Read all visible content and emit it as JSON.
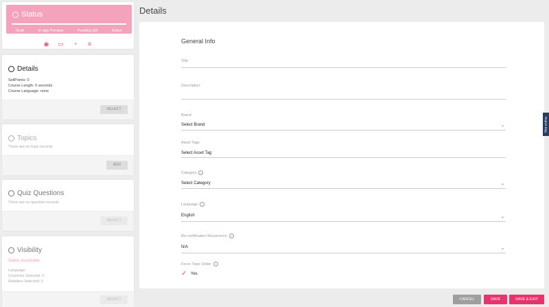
{
  "sidebar": {
    "status": {
      "title": "Status",
      "steps": [
        "Draft",
        "In-app Preview",
        "Pending QA",
        "Active"
      ],
      "progress": 1.0,
      "icons": [
        "eye-icon",
        "chat-icon",
        "history-icon",
        "list-icon"
      ]
    },
    "details": {
      "title": "Details",
      "lines": [
        "SellPoints: 0",
        "Course Length: 0 seconds",
        "Course Language: none"
      ],
      "button": "SELECT"
    },
    "topics": {
      "title": "Topics",
      "empty": "There are no topic records",
      "button": "ADD"
    },
    "quiz": {
      "title": "Quiz Questions",
      "empty": "There are no question records",
      "button": "SELECT"
    },
    "visibility": {
      "title": "Visibility",
      "link": "Sales Associate",
      "lines": [
        "Language:",
        "Countries Selected: 0",
        "Retailers Selected: 0"
      ],
      "button": "SELECT"
    }
  },
  "main": {
    "title": "Details",
    "section": "General Info",
    "fields": {
      "title": {
        "label": "Title",
        "value": ""
      },
      "description": {
        "label": "Description",
        "value": ""
      },
      "brand": {
        "label": "Brand",
        "value": "Select Brand"
      },
      "asset_tags": {
        "label": "Asset Tags",
        "value": "Select Asset Tag"
      },
      "category": {
        "label": "Category",
        "value": "Select Category"
      },
      "language": {
        "label": "Language",
        "value": "English"
      },
      "recert": {
        "label": "Re-certification Recurrence",
        "value": "N/A"
      },
      "force_order": {
        "label": "Force Topic Order",
        "value": "Yes"
      }
    }
  },
  "actions": {
    "cancel": "CANCEL",
    "save": "SAVE",
    "save_exit": "SAVE & EXIT"
  },
  "side_tab": "Report Bug",
  "colors": {
    "accent": "#e8336e",
    "status_bg": "#f5a3bd",
    "cancel": "#9e9e9e",
    "side_tab": "#2a3b63"
  }
}
